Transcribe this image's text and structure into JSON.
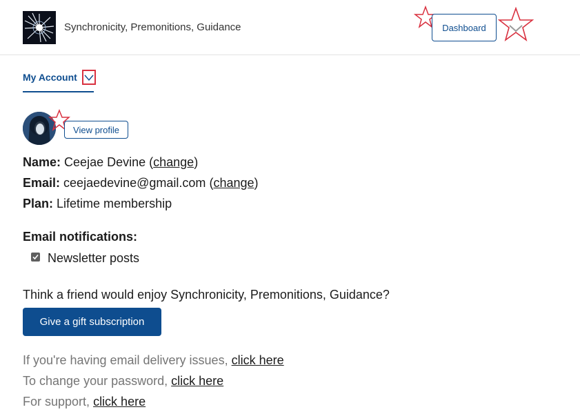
{
  "header": {
    "site_title": "Synchronicity, Premonitions, Guidance",
    "dashboard_label": "Dashboard"
  },
  "tabs": {
    "active_label": "My Account"
  },
  "profile": {
    "view_profile_label": "View profile"
  },
  "account": {
    "name_label": "Name:",
    "name_value": "Ceejae Devine",
    "name_change": "change",
    "email_label": "Email:",
    "email_value": "ceejaedevine@gmail.com",
    "email_change": "change",
    "plan_label": "Plan:",
    "plan_value": "Lifetime membership"
  },
  "notifications": {
    "title": "Email notifications:",
    "newsletter_label": "Newsletter posts",
    "newsletter_checked": true
  },
  "gift": {
    "prompt": "Think a friend would enjoy Synchronicity, Premonitions, Guidance?",
    "button_label": "Give a gift subscription"
  },
  "help": {
    "delivery_text": "If you're having email delivery issues,",
    "delivery_link": "click here",
    "password_text": "To change your password,",
    "password_link": "click here",
    "support_text": "For support,",
    "support_link": "click here"
  },
  "colors": {
    "accent": "#0e4d8f",
    "annotation": "#d9303f"
  },
  "icons": [
    "logo-icon",
    "chevron-down-icon",
    "avatar",
    "checkbox-check-icon",
    "star-annotation-icon"
  ]
}
